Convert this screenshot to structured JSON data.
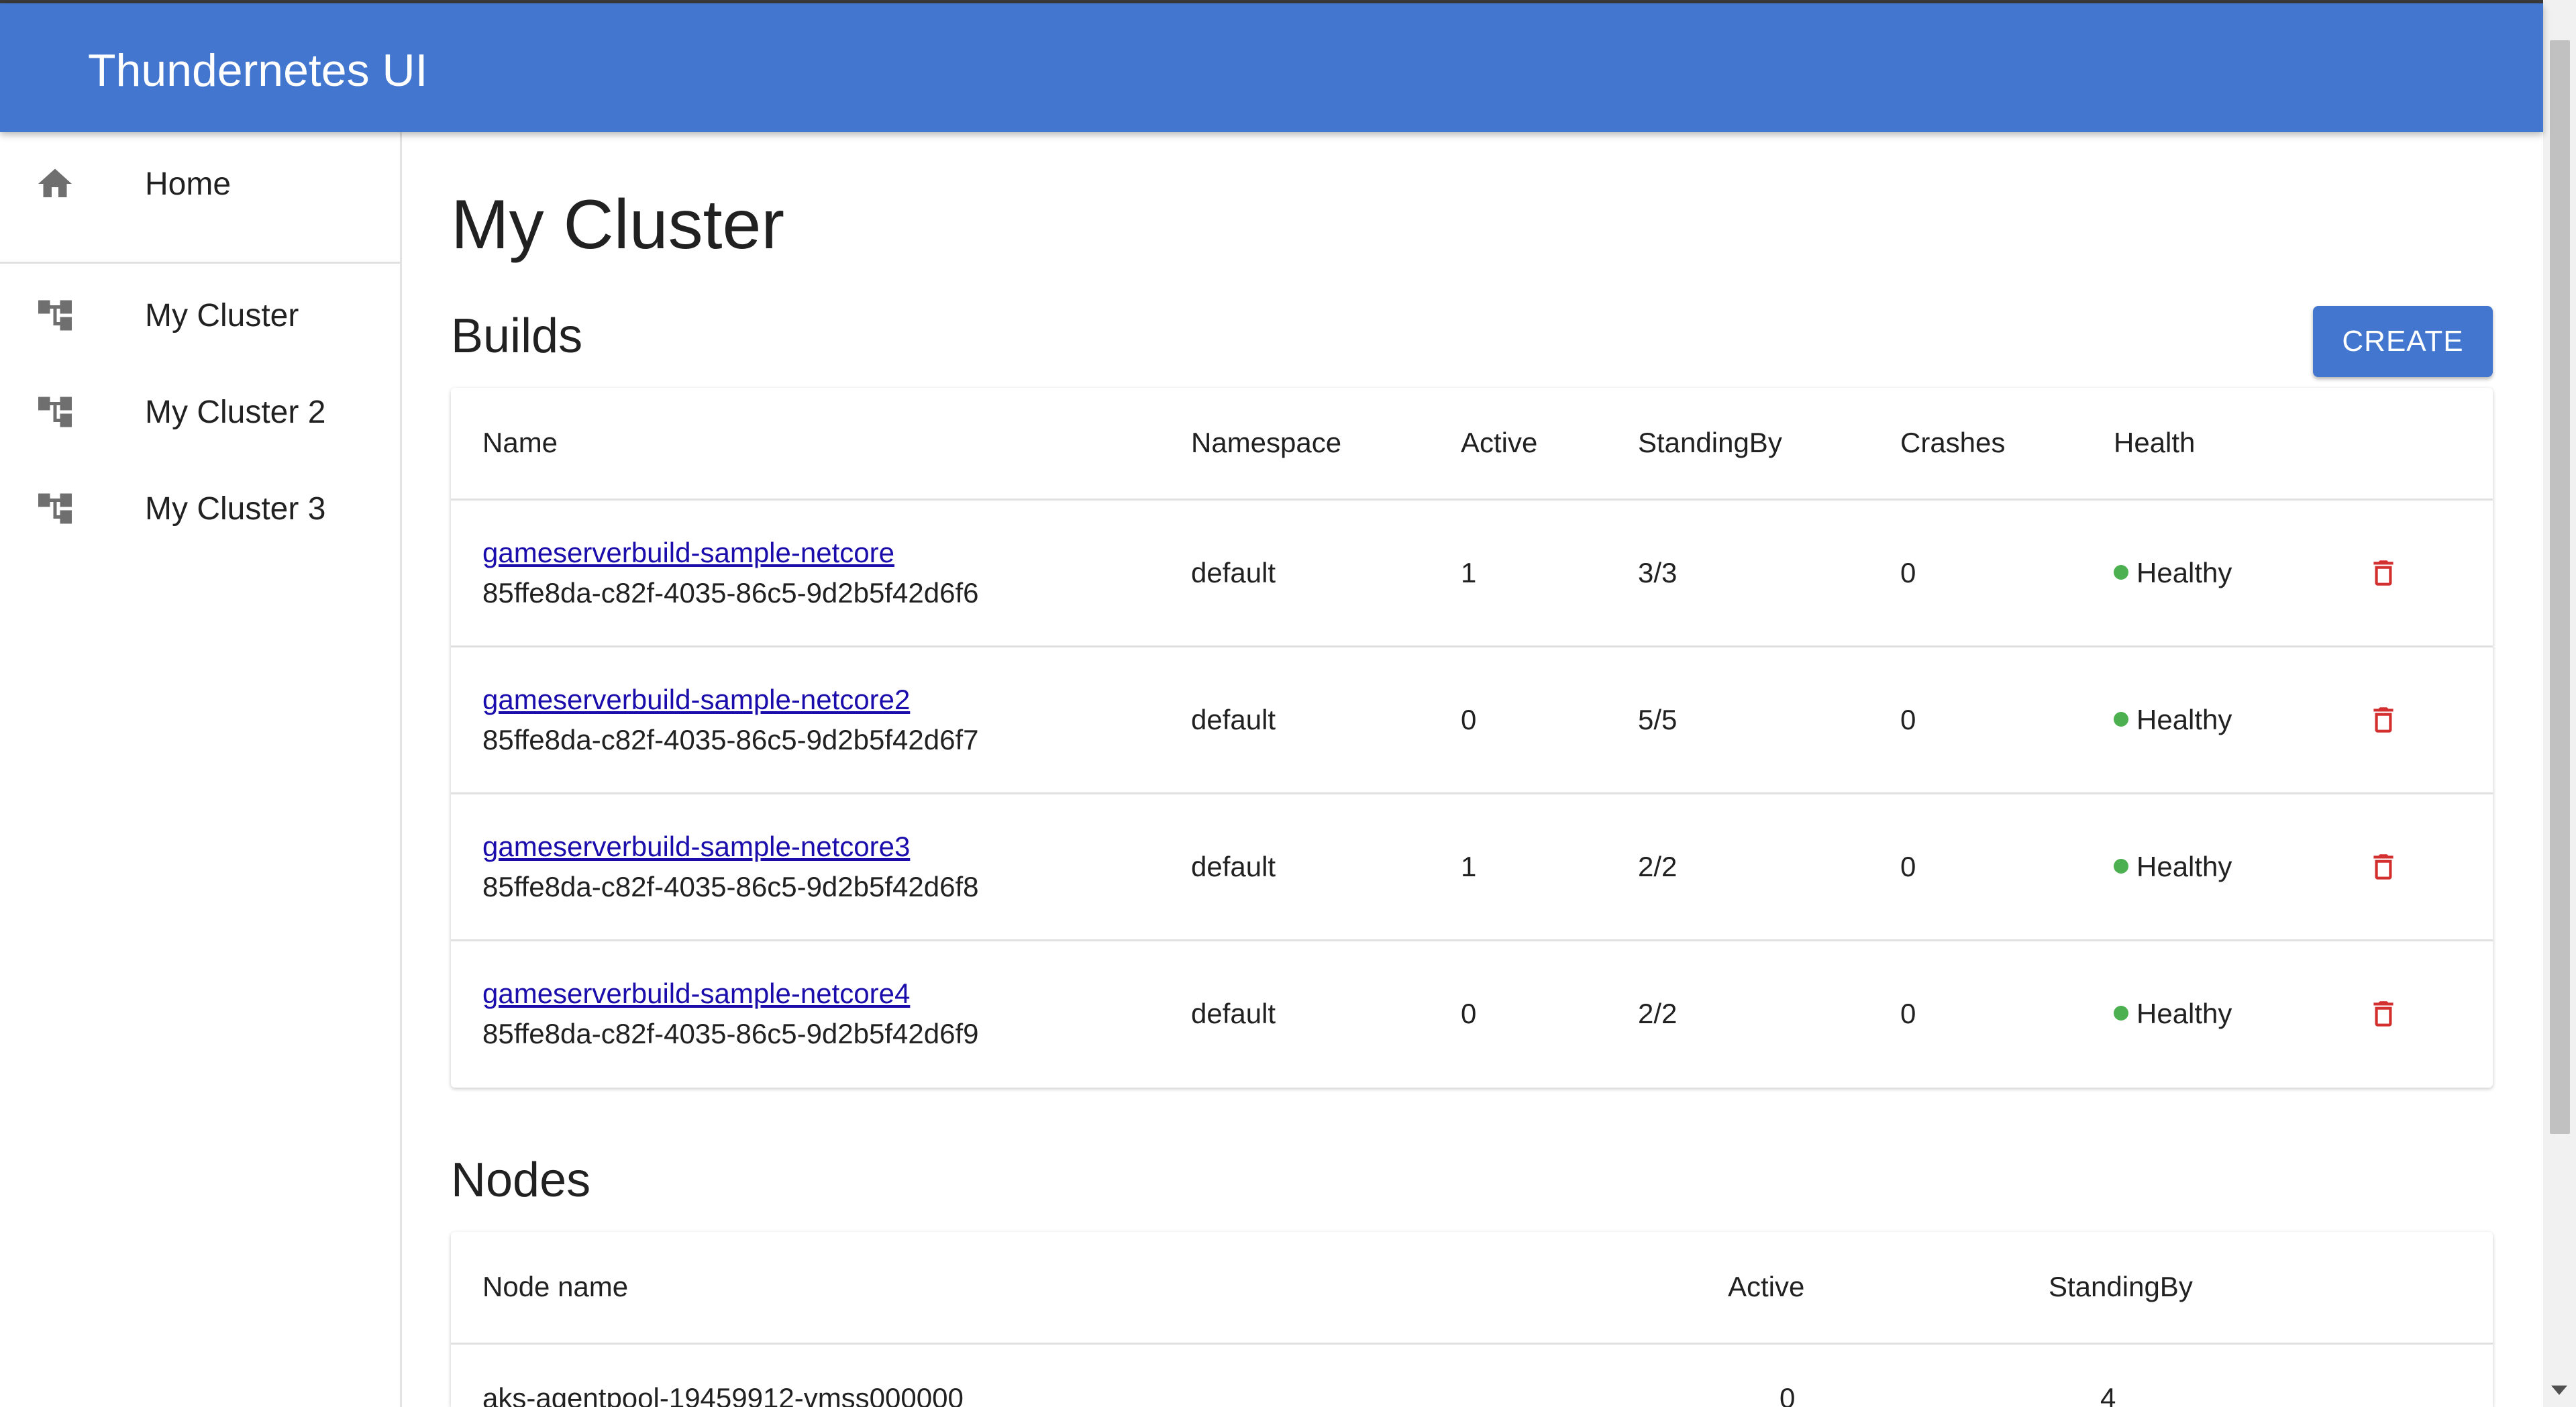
{
  "app": {
    "title": "Thundernetes UI"
  },
  "sidebar": {
    "items": [
      {
        "label": "Home",
        "icon": "home-icon"
      },
      {
        "label": "My Cluster",
        "icon": "account-tree-icon"
      },
      {
        "label": "My Cluster 2",
        "icon": "account-tree-icon"
      },
      {
        "label": "My Cluster 3",
        "icon": "account-tree-icon"
      }
    ]
  },
  "main": {
    "page_title": "My Cluster",
    "builds": {
      "title": "Builds",
      "create_label": "CREATE",
      "columns": [
        "Name",
        "Namespace",
        "Active",
        "StandingBy",
        "Crashes",
        "Health"
      ],
      "rows": [
        {
          "name": "gameserverbuild-sample-netcore",
          "id": "85ffe8da-c82f-4035-86c5-9d2b5f42d6f6",
          "namespace": "default",
          "active": "1",
          "standingby": "3/3",
          "crashes": "0",
          "health": "Healthy"
        },
        {
          "name": "gameserverbuild-sample-netcore2",
          "id": "85ffe8da-c82f-4035-86c5-9d2b5f42d6f7",
          "namespace": "default",
          "active": "0",
          "standingby": "5/5",
          "crashes": "0",
          "health": "Healthy"
        },
        {
          "name": "gameserverbuild-sample-netcore3",
          "id": "85ffe8da-c82f-4035-86c5-9d2b5f42d6f8",
          "namespace": "default",
          "active": "1",
          "standingby": "2/2",
          "crashes": "0",
          "health": "Healthy"
        },
        {
          "name": "gameserverbuild-sample-netcore4",
          "id": "85ffe8da-c82f-4035-86c5-9d2b5f42d6f9",
          "namespace": "default",
          "active": "0",
          "standingby": "2/2",
          "crashes": "0",
          "health": "Healthy"
        }
      ]
    },
    "nodes": {
      "title": "Nodes",
      "columns": [
        "Node name",
        "Active",
        "StandingBy"
      ],
      "rows": [
        {
          "name": "aks-agentpool-19459912-vmss000000",
          "active": "0",
          "standingby": "4"
        }
      ]
    }
  },
  "colors": {
    "primary": "#4376cf",
    "healthy": "#4caf50",
    "delete": "#d32f2f",
    "link": "#1a0dab"
  }
}
